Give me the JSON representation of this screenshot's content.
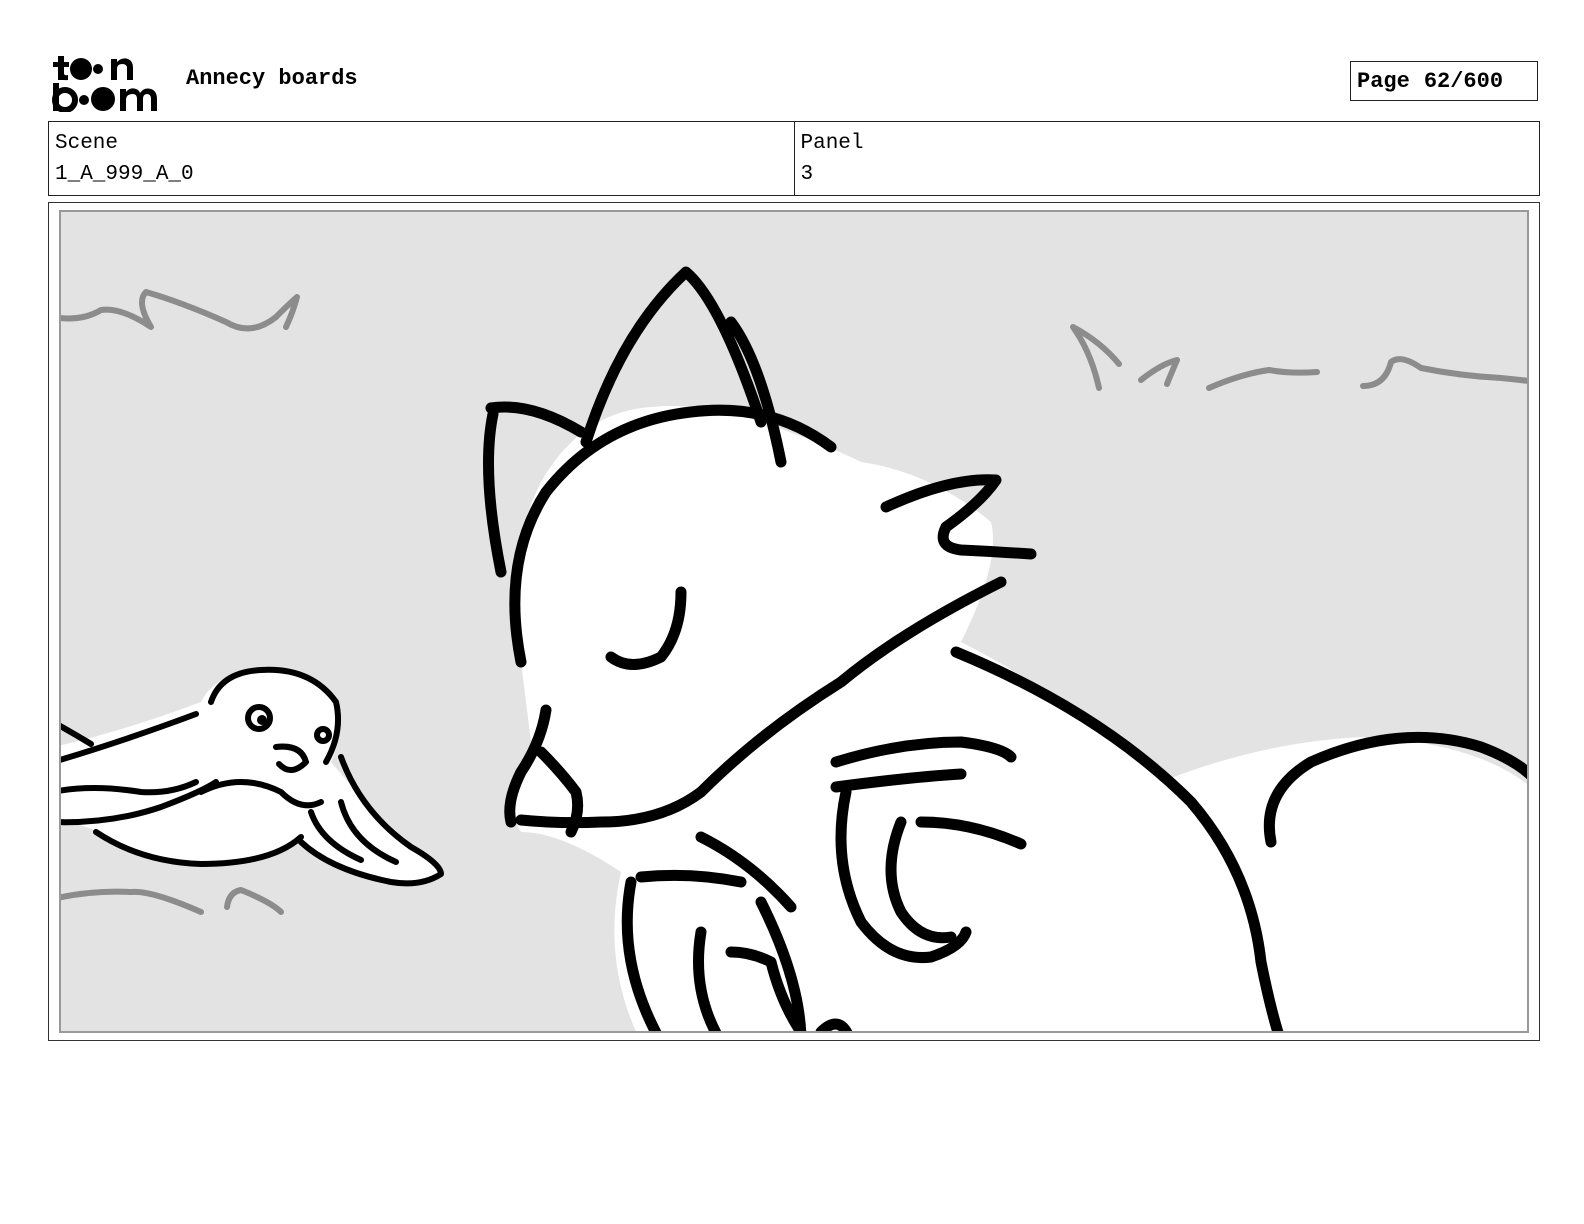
{
  "header": {
    "logo_text": "toon boom",
    "title": "Annecy boards",
    "page_label": "Page",
    "page_number": "62/600"
  },
  "info": {
    "scene_label": "Scene",
    "scene_value": "1_A_999_A_0",
    "panel_label": "Panel",
    "panel_value": "3"
  },
  "colors": {
    "panel_background": "#e3e3e3",
    "ink": "#000000",
    "background_strokes": "#8c8c8c"
  }
}
